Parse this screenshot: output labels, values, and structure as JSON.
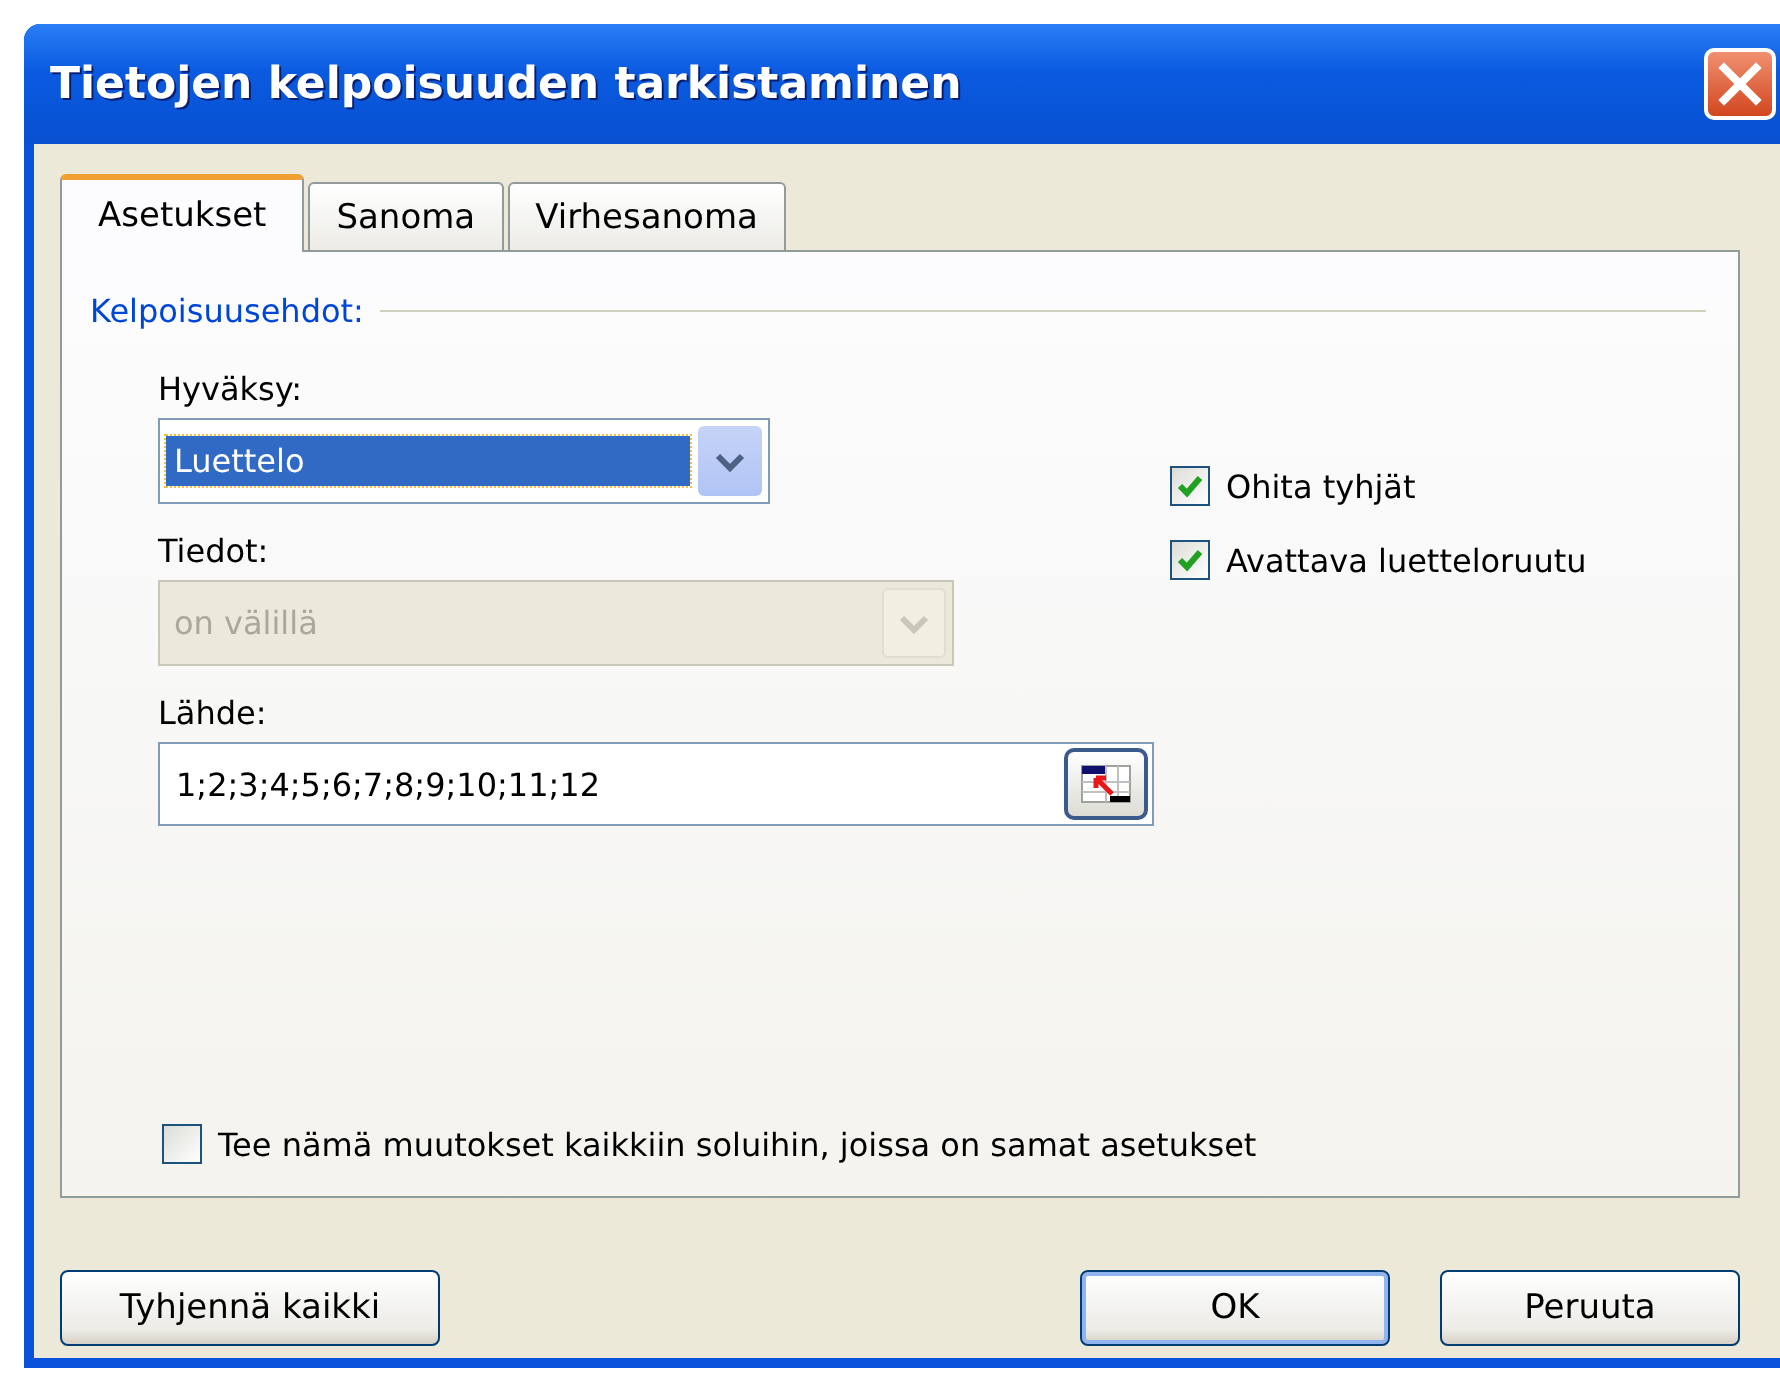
{
  "window": {
    "title": "Tietojen kelpoisuuden tarkistaminen"
  },
  "tabs": [
    {
      "label": "Asetukset",
      "selected": true
    },
    {
      "label": "Sanoma",
      "selected": false
    },
    {
      "label": "Virhesanoma",
      "selected": false
    }
  ],
  "group": {
    "title": "Kelpoisuusehdot:"
  },
  "fields": [
    {
      "kind": "combo",
      "label": "Hyväksy:",
      "value": "Luettelo",
      "disabled": false,
      "focused": true
    },
    {
      "kind": "combo",
      "label": "Tiedot:",
      "value": "on välillä",
      "disabled": true
    },
    {
      "kind": "reference",
      "label": "Lähde:",
      "value": "1;2;3;4;5;6;7;8;9;10;11;12",
      "disabled": false
    }
  ],
  "options": [
    {
      "label": "Ohita tyhjät",
      "checked": true
    },
    {
      "label": "Avattava luetteloruutu",
      "checked": true
    }
  ],
  "apply_all": {
    "label": "Tee nämä muutokset kaikkiin soluihin, joissa on samat asetukset",
    "checked": false
  },
  "buttons": [
    {
      "label": "Tyhjennä kaikki",
      "default": false
    },
    {
      "label": "OK",
      "default": true
    },
    {
      "label": "Peruuta",
      "default": false
    }
  ]
}
